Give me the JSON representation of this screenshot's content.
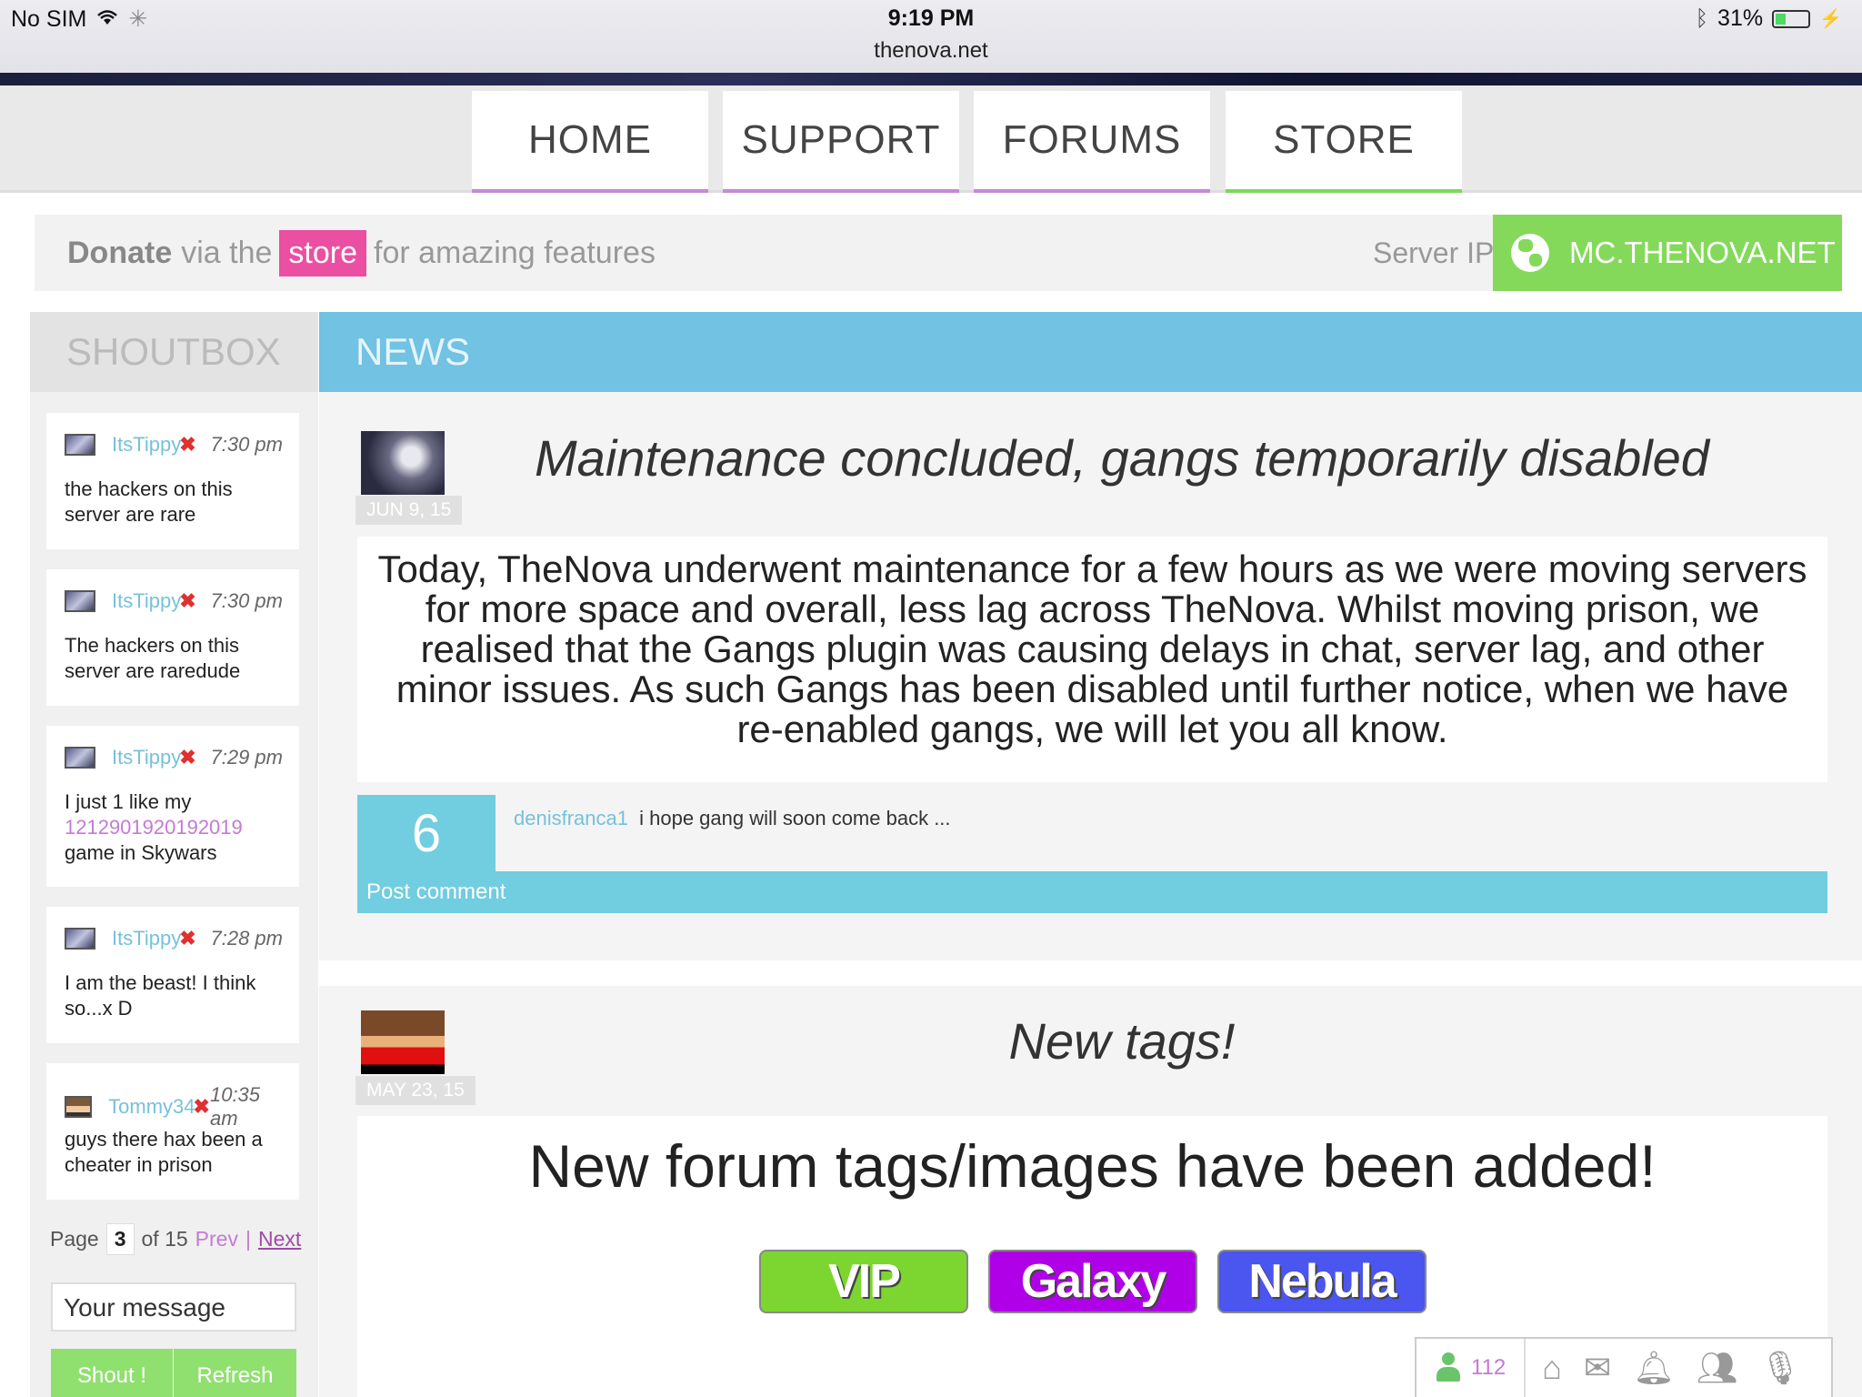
{
  "status": {
    "carrier": "No SIM",
    "time": "9:19 PM",
    "url": "thenova.net",
    "battery": "31%",
    "battery_level": 0.31
  },
  "nav": [
    {
      "label": "HOME"
    },
    {
      "label": "SUPPORT"
    },
    {
      "label": "FORUMS"
    },
    {
      "label": "STORE"
    }
  ],
  "donate": {
    "strong": "Donate",
    "pre": "via the",
    "store": "store",
    "post": "for amazing features",
    "server_label": "Server IP:",
    "server_ip": "MC.THENOVA.NET"
  },
  "shoutbox": {
    "title": "SHOUTBOX",
    "messages": [
      {
        "user": "ItsTippy",
        "time": "7:30 pm",
        "text": "the hackers on this server are rare"
      },
      {
        "user": "ItsTippy",
        "time": "7:30 pm",
        "text": "The hackers on this server are raredude"
      },
      {
        "user": "ItsTippy",
        "time": "7:29 pm",
        "text_pre": "I just 1 like my",
        "text_link": "1212901920192019",
        "text_post": "game in Skywars"
      },
      {
        "user": "ItsTippy",
        "time": "7:28 pm",
        "text": "I am the beast! I think so...x D"
      },
      {
        "user": "Tommy34",
        "time": "10:35 am",
        "text": "guys there hax been a cheater in prison"
      }
    ],
    "pager": {
      "page": "Page",
      "current": "3",
      "of": "of 15",
      "prev": "Prev",
      "sep": "|",
      "next": "Next"
    },
    "input_placeholder": "Your message",
    "shout_btn": "Shout !",
    "refresh_btn": "Refresh"
  },
  "news": {
    "title": "NEWS",
    "articles": [
      {
        "date": "JUN 9, 15",
        "title": "Maintenance concluded, gangs temporarily disabled",
        "body": "Today, TheNova underwent maintenance for a few hours as we were moving servers for more space and overall, less lag across TheNova. Whilst moving prison, we realised that the Gangs plugin was causing delays in chat, server lag, and other minor issues. As such Gangs has been disabled until further notice, when we have re-enabled gangs, we will let you all know.",
        "comments": "6",
        "last_comment_user": "denisfranca1",
        "last_comment": "i hope gang will soon come back ...",
        "post_comment": "Post comment"
      },
      {
        "date": "MAY 23, 15",
        "title": "New tags!",
        "body": "New forum tags/images have been added!",
        "tags": [
          "VIP",
          "Galaxy",
          "Nebula"
        ]
      }
    ]
  },
  "bottombar": {
    "online": "112",
    "icons": [
      "home-icon",
      "mail-icon",
      "bell-icon",
      "group-icon",
      "mic-icon"
    ]
  },
  "colors": {
    "accent_blue": "#71c2e3",
    "green": "#84d95a",
    "pink": "#ea4fa1",
    "purple": "#c57ad6"
  }
}
